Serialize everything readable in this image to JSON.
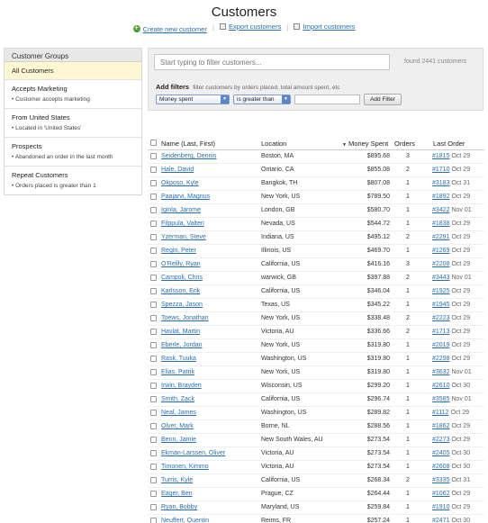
{
  "header": {
    "title": "Customers",
    "actions": [
      {
        "label": "Create new customer",
        "icon": "plus-icon"
      },
      {
        "label": "Export customers",
        "icon": "document-icon"
      },
      {
        "label": "Import customers",
        "icon": "document-icon"
      }
    ]
  },
  "sidebar": {
    "title": "Customer Groups",
    "groups": [
      {
        "name": "All Customers",
        "desc": "",
        "active": true
      },
      {
        "name": "Accepts Marketing",
        "desc": "Customer accepts marketing"
      },
      {
        "name": "From United States",
        "desc": "Located in 'United States'"
      },
      {
        "name": "Prospects",
        "desc": "Abandoned an order in the last month"
      },
      {
        "name": "Repeat Customers",
        "desc": "Orders placed is greater than 1"
      }
    ]
  },
  "filters": {
    "search_placeholder": "Start typing to filter customers...",
    "found_text": "found 2441 customers",
    "add_title": "Add filters",
    "add_subtitle": "filter customers by orders placed, total amount spent, etc",
    "field_select": "Money spent",
    "operator_select": "is greater than",
    "value": "",
    "add_button": "Add Filter"
  },
  "table": {
    "headers": {
      "name": "Name (Last, First)",
      "location": "Location",
      "spent": "Money Spent",
      "orders": "Orders",
      "last": "Last Order"
    },
    "rows": [
      {
        "name": "Seidenberg, Dennis",
        "location": "Boston, MA",
        "spent": "$895.68",
        "orders": "3",
        "last_num": "#1815",
        "last_date": "Oct 29"
      },
      {
        "name": "Hale, David",
        "location": "Ontario, CA",
        "spent": "$855.08",
        "orders": "2",
        "last_num": "#1710",
        "last_date": "Oct 29"
      },
      {
        "name": "Okposo, Kyle",
        "location": "Bangkok, TH",
        "spent": "$807.08",
        "orders": "1",
        "last_num": "#3183",
        "last_date": "Oct 31"
      },
      {
        "name": "Paajarvi, Magnus",
        "location": "New York, US",
        "spent": "$789.50",
        "orders": "1",
        "last_num": "#1892",
        "last_date": "Oct 29"
      },
      {
        "name": "Iginla, Jarome",
        "location": "London, GB",
        "spent": "$580.70",
        "orders": "1",
        "last_num": "#3422",
        "last_date": "Nov 01"
      },
      {
        "name": "Filppula, Valteri",
        "location": "Nevada, US",
        "spent": "$544.72",
        "orders": "1",
        "last_num": "#1838",
        "last_date": "Oct 29"
      },
      {
        "name": "Yzerman, Steve",
        "location": "Indiana, US",
        "spent": "$495.12",
        "orders": "2",
        "last_num": "#2291",
        "last_date": "Oct 29"
      },
      {
        "name": "Regin, Peter",
        "location": "Illinois, US",
        "spent": "$469.70",
        "orders": "1",
        "last_num": "#1269",
        "last_date": "Oct 29"
      },
      {
        "name": "O'Reilly, Ryan",
        "location": "California, US",
        "spent": "$416.16",
        "orders": "3",
        "last_num": "#2208",
        "last_date": "Oct 29"
      },
      {
        "name": "Campoli, Chris",
        "location": "warwick, GB",
        "spent": "$397.88",
        "orders": "2",
        "last_num": "#3443",
        "last_date": "Nov 01"
      },
      {
        "name": "Karlsson, Erik",
        "location": "California, US",
        "spent": "$346.04",
        "orders": "1",
        "last_num": "#1925",
        "last_date": "Oct 29"
      },
      {
        "name": "Spezza, Jason",
        "location": "Texas, US",
        "spent": "$345.22",
        "orders": "1",
        "last_num": "#1945",
        "last_date": "Oct 29"
      },
      {
        "name": "Toews, Jonathan",
        "location": "New York, US",
        "spent": "$338.48",
        "orders": "2",
        "last_num": "#2223",
        "last_date": "Oct 29"
      },
      {
        "name": "Havlat, Martin",
        "location": "Victoria, AU",
        "spent": "$336.66",
        "orders": "2",
        "last_num": "#1713",
        "last_date": "Oct 29"
      },
      {
        "name": "Eberle, Jordan",
        "location": "New York, US",
        "spent": "$319.80",
        "orders": "1",
        "last_num": "#2019",
        "last_date": "Oct 29"
      },
      {
        "name": "Rask, Tuuka",
        "location": "Washington, US",
        "spent": "$319.80",
        "orders": "1",
        "last_num": "#2298",
        "last_date": "Oct 29"
      },
      {
        "name": "Elias, Patrik",
        "location": "New York, US",
        "spent": "$319.80",
        "orders": "1",
        "last_num": "#3632",
        "last_date": "Nov 01"
      },
      {
        "name": "Irwin, Brayden",
        "location": "Wisconsin, US",
        "spent": "$299.20",
        "orders": "1",
        "last_num": "#2610",
        "last_date": "Oct 30"
      },
      {
        "name": "Smith, Zack",
        "location": "California, US",
        "spent": "$296.74",
        "orders": "1",
        "last_num": "#3585",
        "last_date": "Nov 01"
      },
      {
        "name": "Neal, James",
        "location": "Washington, US",
        "spent": "$289.82",
        "orders": "1",
        "last_num": "#1112",
        "last_date": "Oct 29"
      },
      {
        "name": "Olver, Mark",
        "location": "Borne, NL",
        "spent": "$288.56",
        "orders": "1",
        "last_num": "#1862",
        "last_date": "Oct 29"
      },
      {
        "name": "Benn, Jamie",
        "location": "New South Wales, AU",
        "spent": "$273.54",
        "orders": "1",
        "last_num": "#2273",
        "last_date": "Oct 29"
      },
      {
        "name": "Ekman-Larssen, Oliver",
        "location": "Victoria, AU",
        "spent": "$273.54",
        "orders": "1",
        "last_num": "#2405",
        "last_date": "Oct 30"
      },
      {
        "name": "Timonen, Kimmo",
        "location": "Victoria, AU",
        "spent": "$273.54",
        "orders": "1",
        "last_num": "#2608",
        "last_date": "Oct 30"
      },
      {
        "name": "Turris, Kyle",
        "location": "California, US",
        "spent": "$268.34",
        "orders": "2",
        "last_num": "#3335",
        "last_date": "Oct 31"
      },
      {
        "name": "Eager, Ben",
        "location": "Prague, CZ",
        "spent": "$264.44",
        "orders": "1",
        "last_num": "#1062",
        "last_date": "Oct 29"
      },
      {
        "name": "Ryan, Bobby",
        "location": "Maryland, US",
        "spent": "$259.84",
        "orders": "1",
        "last_num": "#1910",
        "last_date": "Oct 29"
      },
      {
        "name": "Neuffert, Quentin",
        "location": "Reims, FR",
        "spent": "$257.24",
        "orders": "1",
        "last_num": "#2471",
        "last_date": "Oct 30"
      }
    ]
  }
}
